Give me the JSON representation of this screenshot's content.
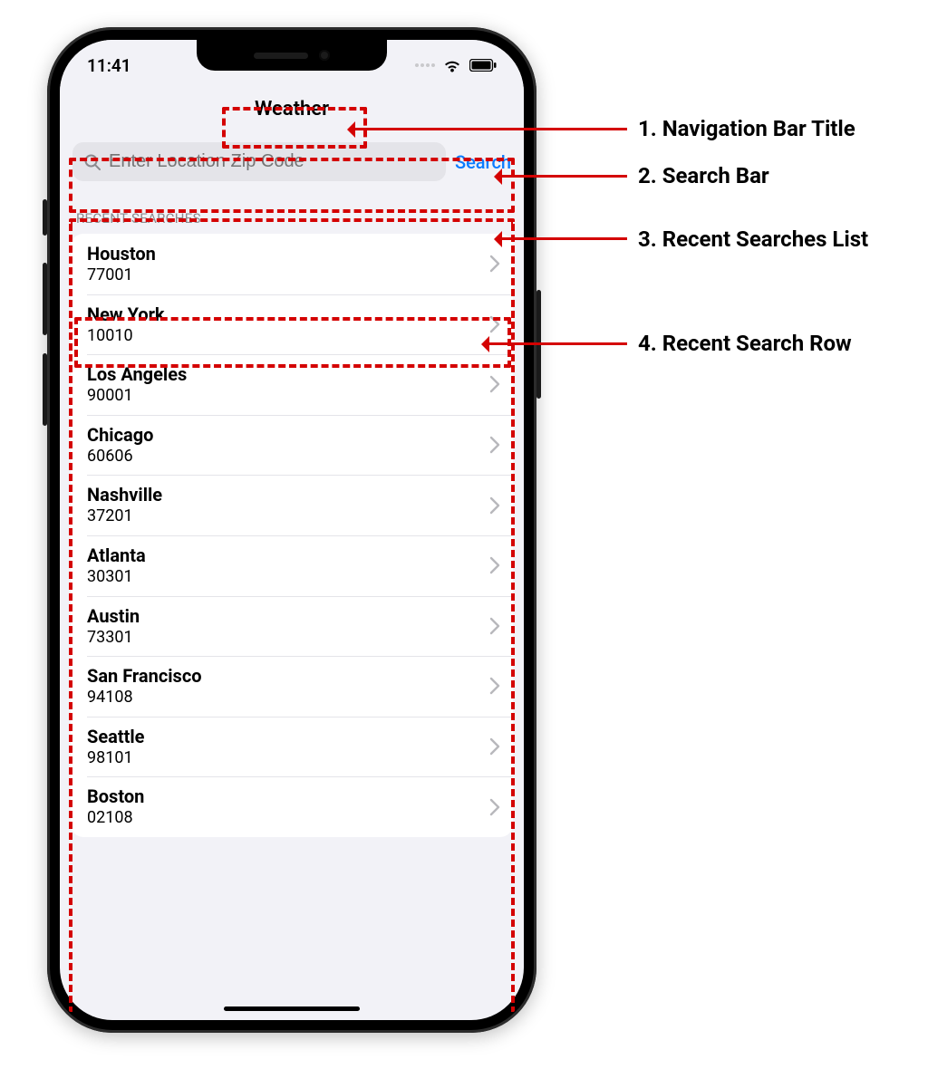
{
  "status_bar": {
    "time": "11:41"
  },
  "nav": {
    "title": "Weather"
  },
  "search": {
    "placeholder": "Enter Location Zip Code",
    "button_label": "Search"
  },
  "recent": {
    "header": "RECENT SEARCHES",
    "items": [
      {
        "city": "Houston",
        "zip": "77001"
      },
      {
        "city": "New York",
        "zip": "10010"
      },
      {
        "city": "Los Angeles",
        "zip": "90001"
      },
      {
        "city": "Chicago",
        "zip": "60606"
      },
      {
        "city": "Nashville",
        "zip": "37201"
      },
      {
        "city": "Atlanta",
        "zip": "30301"
      },
      {
        "city": "Austin",
        "zip": "73301"
      },
      {
        "city": "San Francisco",
        "zip": "94108"
      },
      {
        "city": "Seattle",
        "zip": "98101"
      },
      {
        "city": "Boston",
        "zip": "02108"
      }
    ]
  },
  "annotations": {
    "a1": "1. Navigation Bar Title",
    "a2": "2. Search Bar",
    "a3": "3. Recent Searches List",
    "a4": "4. Recent Search Row"
  },
  "colors": {
    "accent": "#0a7bff",
    "annotation_red": "#d40202",
    "screen_bg": "#f2f2f7",
    "subtle_text": "#8a8a8e"
  }
}
